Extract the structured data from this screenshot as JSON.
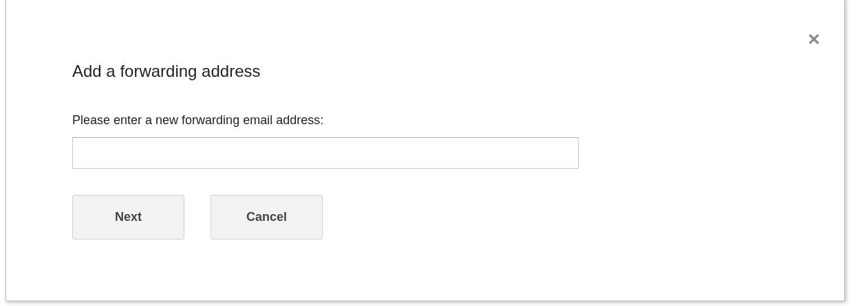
{
  "dialog": {
    "title": "Add a forwarding address",
    "close": "×",
    "label": "Please enter a new forwarding email address:",
    "buttons": [
      {
        "label": "Next"
      },
      {
        "label": "Cancel"
      }
    ]
  }
}
